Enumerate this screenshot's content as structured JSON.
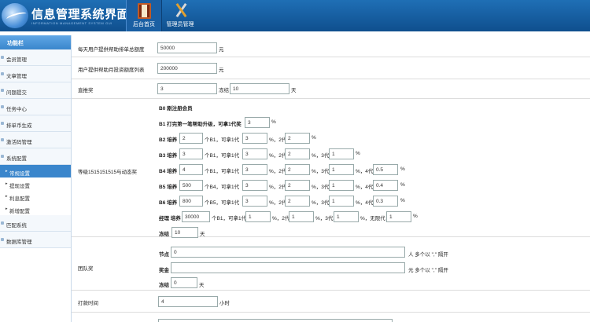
{
  "header": {
    "title": "信息管理系统界面",
    "subtitle": "INFORMATION MANAGEMENT SYSTEM GUI",
    "tabs": [
      {
        "label": "后台首页",
        "icon": "book-icon",
        "active": true
      },
      {
        "label": "管理员管理",
        "icon": "tools-icon",
        "active": false
      }
    ]
  },
  "sidebar": {
    "title": "功能栏",
    "items": [
      "会员管理",
      "文章管理",
      "问题提交",
      "任务中心",
      "排单币生成",
      "激活码管理",
      "系统配置"
    ],
    "subitems": [
      "常规设置",
      "提现设置",
      "利息配置",
      "新增配置"
    ],
    "items_after": [
      "匹配系统",
      "数据库管理"
    ]
  },
  "form": {
    "daily_max_label": "每天用户提供帮助排单总额度",
    "daily_max_value": "50000",
    "daily_max_unit": "元",
    "monthly_max_label": "用户提供帮助月投资额度列表",
    "monthly_max_value": "200000",
    "monthly_max_unit": "元",
    "direct_label": "直推奖",
    "direct_value": "3",
    "direct_freeze_label": "冻结",
    "direct_freeze_value": "10",
    "direct_freeze_unit": "天",
    "tier_label": "等级1515151515与动态奖",
    "b0": "B0 刚注册会员",
    "b1_text": "B1 打完第一笔帮助升级，可拿1代奖",
    "b1_v1": "3",
    "pct": "%",
    "b2_prefix": "B2 培养",
    "b2_count": "2",
    "b2_mid": "个B1，可拿1代",
    "b2_v1": "3",
    "b2_v2": "2",
    "b3_prefix": "B3 培养",
    "b3_count": "3",
    "b3_mid": "个B1，可拿1代",
    "b3_v1": "3",
    "b3_v2": "2",
    "b3_v3": "1",
    "b4_prefix": "B4 培养",
    "b4_count": "4",
    "b4_mid": "个B1，可拿1代",
    "b4_v1": "3",
    "b4_v2": "2",
    "b4_v3": "1",
    "b4_v4": "0.5",
    "b5_prefix": "B5 培养",
    "b5_count": "500",
    "b5_mid": "个B4，可拿1代",
    "b5_v1": "3",
    "b5_v2": "2",
    "b5_v3": "1",
    "b5_v4": "0.4",
    "b6_prefix": "B6 培养",
    "b6_count": "800",
    "b6_mid": "个B5，可拿1代",
    "b6_v1": "3",
    "b6_v2": "2",
    "b6_v3": "1",
    "b6_v4": "0.3",
    "gen2": "%，2代",
    "gen3": "%，3代",
    "gen4": "%，4代",
    "mgr_prefix": "经理 培养",
    "mgr_count": "30000",
    "mgr_mid": "个B1，可拿1代",
    "mgr_v1": "1",
    "mgr_v2": "1",
    "mgr_v3": "1",
    "mgr_unlimited": "%，无限代",
    "mgr_v4": "1",
    "tier_freeze_label": "冻结",
    "tier_freeze_value": "10",
    "tier_freeze_unit": "天",
    "team_label": "团队奖",
    "node_label": "节点",
    "node_value": "0",
    "node_hint": "人 多个以 \",\" 隔开",
    "bonus_label": "奖金",
    "bonus_value": "",
    "bonus_hint": "元 多个以 \",\" 隔开",
    "team_freeze_label": "冻结",
    "team_freeze_value": "0",
    "team_freeze_unit": "天",
    "pay_time_label": "打款时间",
    "pay_time_value": "4",
    "pay_time_unit": "小时"
  }
}
